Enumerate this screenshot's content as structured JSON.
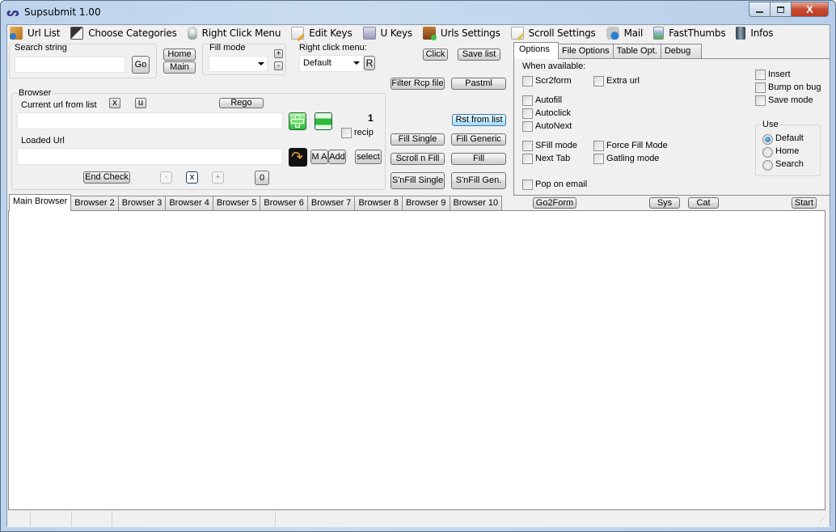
{
  "window": {
    "title": "Supsubmit 1.00",
    "controls": {
      "minimize": "—",
      "maximize": "□",
      "close": "X"
    }
  },
  "menu": [
    {
      "label": "Url List",
      "icon": "url-list-icon"
    },
    {
      "label": "Choose Categories",
      "icon": "categories-icon"
    },
    {
      "label": "Right Click Menu",
      "icon": "mouse-icon"
    },
    {
      "label": "Edit Keys",
      "icon": "edit-document-icon"
    },
    {
      "label": "U Keys",
      "icon": "keys-document-icon"
    },
    {
      "label": "Urls Settings",
      "icon": "settings-package-icon"
    },
    {
      "label": "Scroll Settings",
      "icon": "scroll-edit-icon"
    },
    {
      "label": "Mail",
      "icon": "mail-icon"
    },
    {
      "label": "FastThumbs",
      "icon": "thumbnail-icon"
    },
    {
      "label": "Infos",
      "icon": "computer-info-icon"
    }
  ],
  "search": {
    "label": "Search string",
    "value": "",
    "go_label": "Go"
  },
  "nav": {
    "home_label": "Home",
    "main_label": "Main"
  },
  "fill_mode": {
    "label": "Fill mode",
    "value": "",
    "plus_label": "+",
    "minus_label": "-"
  },
  "right_click_menu": {
    "label": "Right click menu:",
    "value": "Default",
    "r_label": "R"
  },
  "browser": {
    "group_label": "Browser",
    "current_url_label": "Current url from list",
    "x_label": "x",
    "u_label": "u",
    "rego_label": "Rego",
    "current_url_value": "",
    "counter": "1",
    "recip_label": "recip",
    "recip_checked": false,
    "loaded_url_label": "Loaded Url",
    "loaded_url_value": "",
    "ma_label": "M A",
    "add_label": "Add",
    "select_label": "select",
    "end_check_label": "End Check",
    "minus_label": "-",
    "x2_label": "x",
    "plus_label": "+",
    "zero_label": "0"
  },
  "action_buttons": {
    "click": "Click",
    "save_list": "Save list",
    "filter_rcp": "Filter Rcp file",
    "pastml": "Pastml",
    "rst_from_list": "Rst from list",
    "fill_single": "Fill Single",
    "fill_generic": "Fill Generic",
    "scroll_n_fill": "Scroll n Fill",
    "fill": "Fill",
    "snfill_single": "S'nFill Single",
    "snfill_gen": "S'nFill Gen."
  },
  "options_tabs": [
    "Options",
    "File Options",
    "Table Opt.",
    "Debug"
  ],
  "options": {
    "when_available": "When available:",
    "checkboxes": [
      {
        "label": "Scr2form",
        "checked": false
      },
      {
        "label": "Extra url",
        "checked": false
      },
      {
        "label": "Autofill",
        "checked": false
      },
      {
        "label": "Autoclick",
        "checked": false
      },
      {
        "label": "AutoNext",
        "checked": false
      },
      {
        "label": "SFill mode",
        "checked": false
      },
      {
        "label": "Force Fill Mode",
        "checked": false
      },
      {
        "label": "Next Tab",
        "checked": false
      },
      {
        "label": "Gatling mode",
        "checked": false
      },
      {
        "label": "Pop on email",
        "checked": false
      },
      {
        "label": "Insert",
        "checked": false
      },
      {
        "label": "Bump on bug",
        "checked": false
      },
      {
        "label": "Save mode",
        "checked": false
      }
    ],
    "use_group": {
      "label": "Use",
      "options": [
        "Default",
        "Home",
        "Search"
      ],
      "selected": "Default"
    }
  },
  "browser_tabs": [
    "Main Browser",
    "Browser 2",
    "Browser 3",
    "Browser 4",
    "Browser 5",
    "Browser 6",
    "Browser 7",
    "Browser 8",
    "Browser 9",
    "Browser 10"
  ],
  "bottom_buttons": {
    "go2form": "Go2Form",
    "sys": "Sys",
    "cat": "Cat",
    "start": "Start"
  }
}
